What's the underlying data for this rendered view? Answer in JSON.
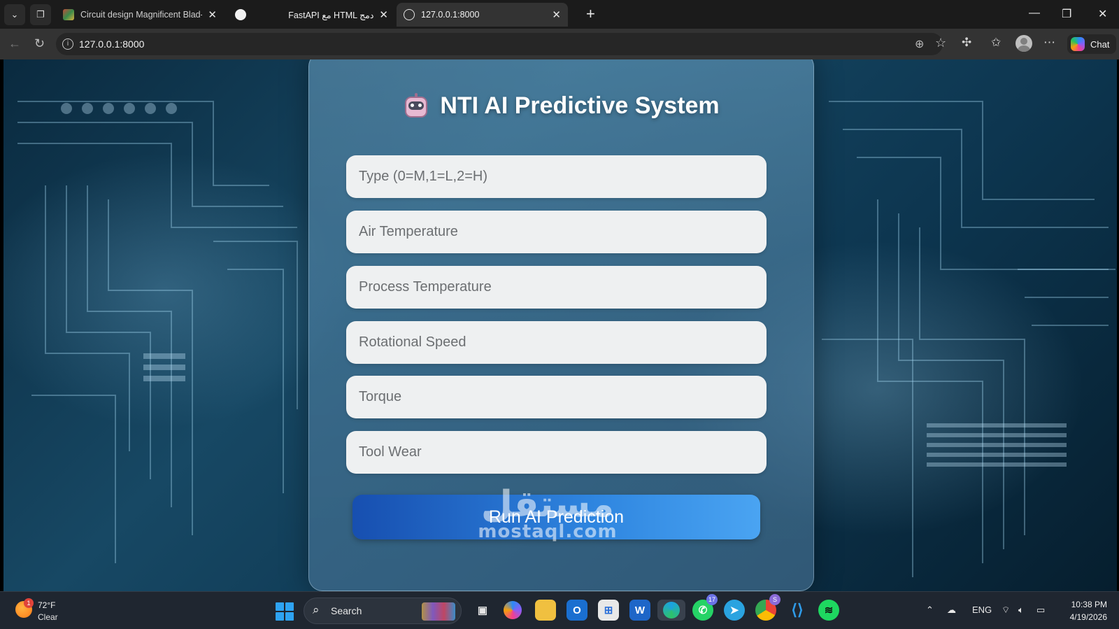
{
  "browser": {
    "tabs": [
      {
        "title": "Circuit design Magnificent Blad-Ea",
        "active": false,
        "favicon_color": "#c04a3a"
      },
      {
        "title": "",
        "active": false,
        "favicon_color": "#ffffff"
      },
      {
        "title": "FastAPI مع HTML دمج",
        "active": false,
        "favicon_color": ""
      },
      {
        "title": "127.0.0.1:8000",
        "active": true,
        "favicon_color": "globe"
      }
    ],
    "url": "127.0.0.1:8000",
    "chat_label": "Chat"
  },
  "page": {
    "title": "NTI AI Predictive System",
    "fields": [
      {
        "placeholder": "Type (0=M,1=L,2=H)",
        "value": ""
      },
      {
        "placeholder": "Air Temperature",
        "value": ""
      },
      {
        "placeholder": "Process Temperature",
        "value": ""
      },
      {
        "placeholder": "Rotational Speed",
        "value": ""
      },
      {
        "placeholder": "Torque",
        "value": ""
      },
      {
        "placeholder": "Tool Wear",
        "value": ""
      }
    ],
    "button_label": "Run AI Prediction",
    "watermark": {
      "arabic": "مستقل",
      "latin": "mostaql.com"
    }
  },
  "taskbar": {
    "weather_temp": "72°F",
    "weather_condition": "Clear",
    "weather_badge": "1",
    "search_label": "Search",
    "whatsapp_badge": "17",
    "chrome_badge": "S",
    "language": "ENG",
    "time": "10:38 PM",
    "date": "4/19/2026"
  },
  "colors": {
    "button_start": "#174fb0",
    "button_end": "#4aa4f2",
    "taskbar_bg": "#1f2630",
    "browser_chrome": "#333333"
  }
}
